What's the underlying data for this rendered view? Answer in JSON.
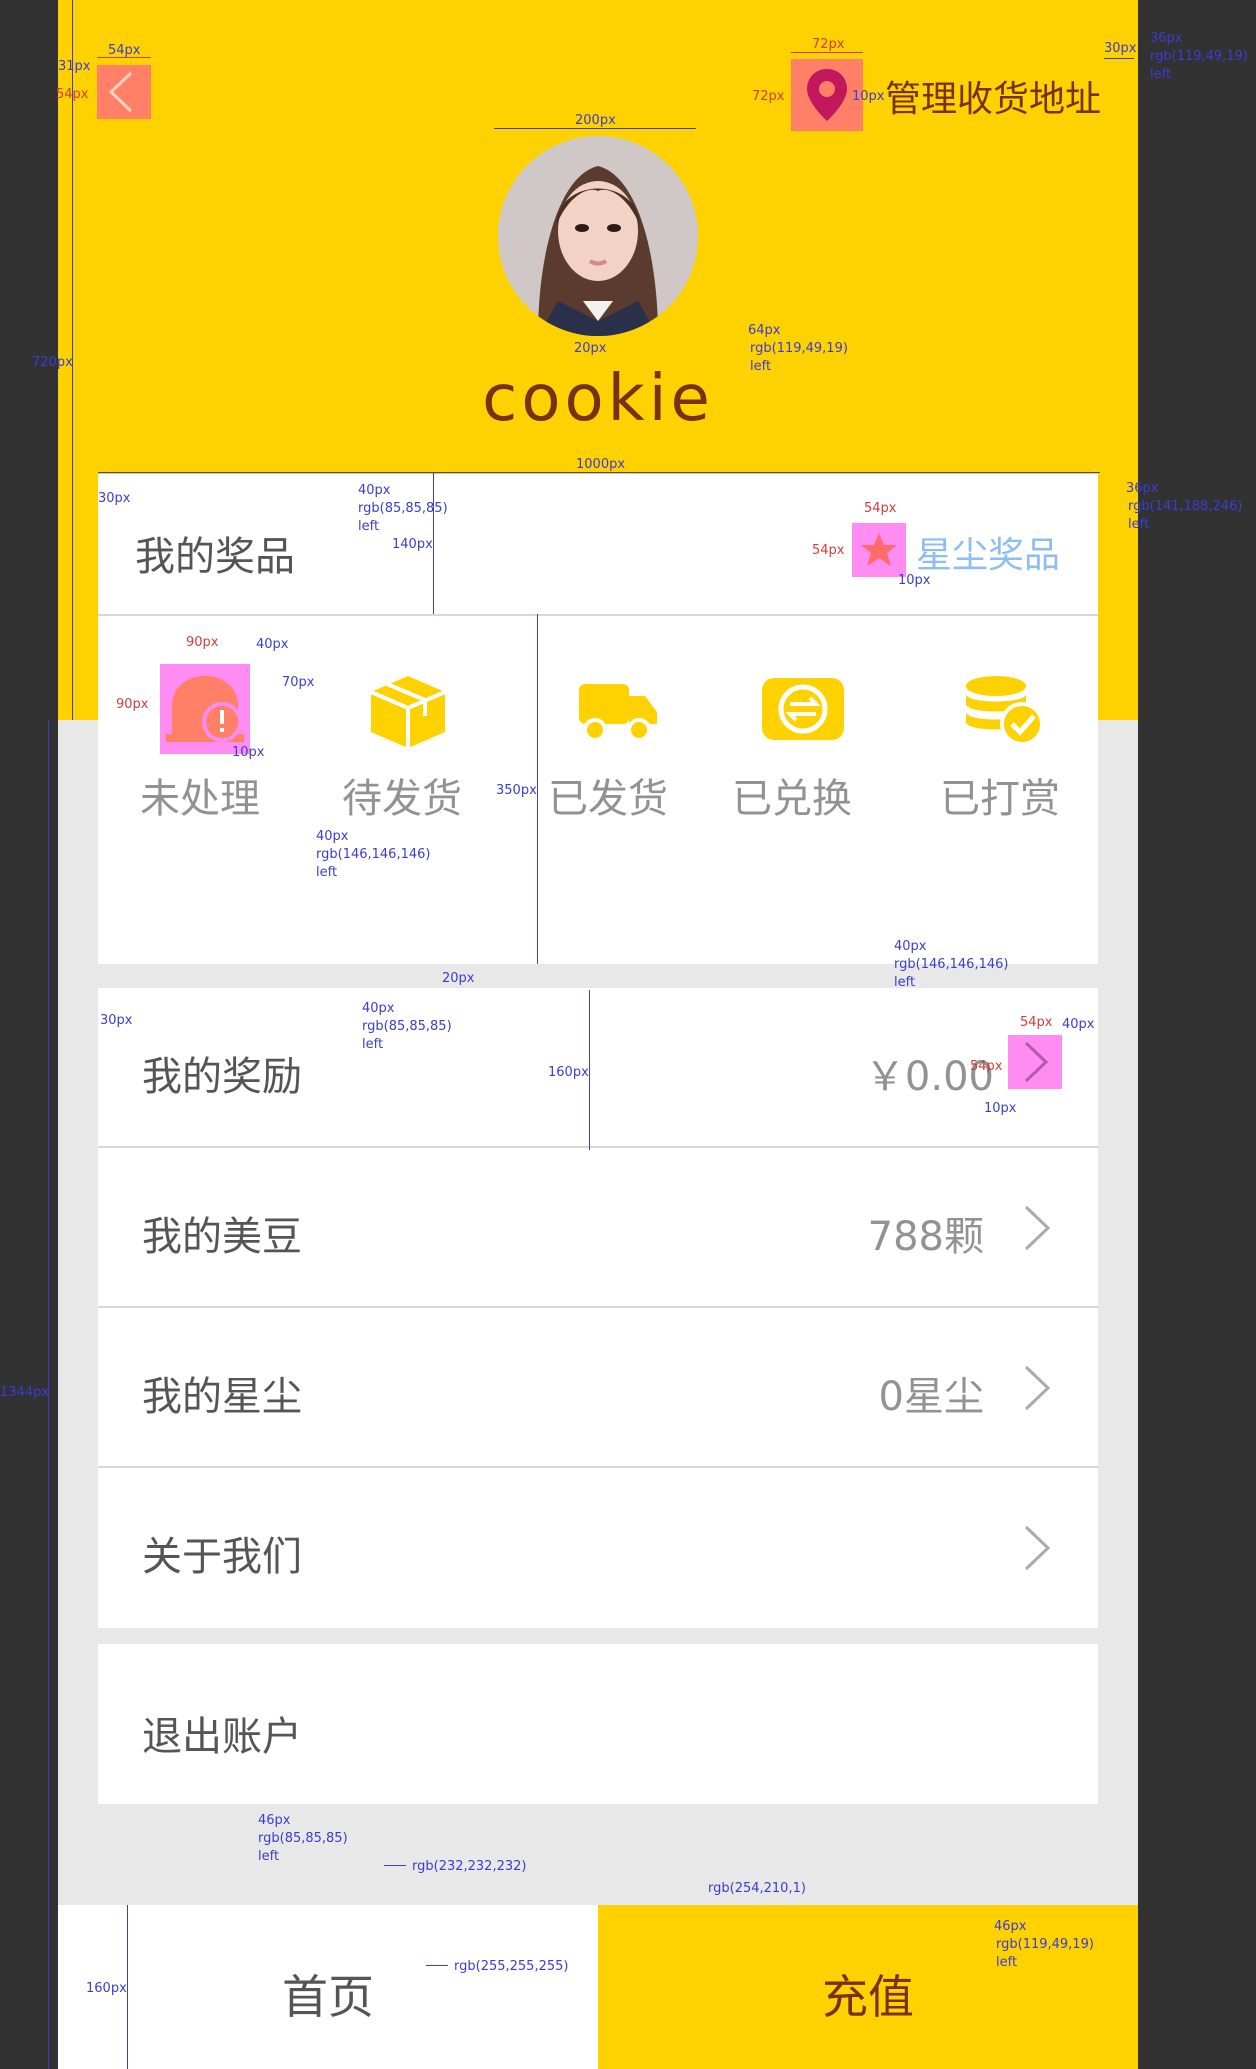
{
  "header": {
    "back_icon": "chevron-left-icon",
    "address_icon": "location-pin-icon",
    "address_label": "管理收货地址",
    "username": "cookie",
    "avatar": "user-avatar-photo"
  },
  "prizes": {
    "title": "我的奖品",
    "link_icon": "star-icon",
    "link_label": "星尘奖品",
    "tabs": [
      {
        "label": "未处理",
        "icon": "bell-alert-icon"
      },
      {
        "label": "待发货",
        "icon": "package-icon"
      },
      {
        "label": "已发货",
        "icon": "truck-icon"
      },
      {
        "label": "已兑换",
        "icon": "exchange-icon"
      },
      {
        "label": "已打赏",
        "icon": "coin-check-icon"
      }
    ]
  },
  "menu": {
    "rows": [
      {
        "label": "我的奖励",
        "value": "￥0.00"
      },
      {
        "label": "我的美豆",
        "value": "788颗"
      },
      {
        "label": "我的星尘",
        "value": "0星尘"
      },
      {
        "label": "关于我们",
        "value": ""
      }
    ],
    "logout": "退出账户"
  },
  "bottom_nav": {
    "home": "首页",
    "recharge": "充值"
  },
  "colors": {
    "accent": "#fed201",
    "dark_brown": "#773113",
    "text_dark": "#555555",
    "text_gray": "#929292",
    "link_blue": "#8dbcf6",
    "page_bg": "#e8e8e8",
    "highlight_pink": "#ff8cf0",
    "highlight_salmon": "#ff8066"
  },
  "annotations": {
    "a1": "31px",
    "a2": "54px",
    "a3": "54px",
    "a4": "72px",
    "a5": "72px",
    "a6": "10px",
    "a7": "36px",
    "a8": "rgb(119,49,19)",
    "a9": "left",
    "a10": "30px",
    "a11": "200px",
    "a12": "20px",
    "a13": "64px",
    "a14": "rgb(119,49,19)",
    "a15": "left",
    "a16": "720px",
    "a17": "1000px",
    "a18": "30px",
    "a19": "40px",
    "a20": "rgb(85,85,85)",
    "a21": "left",
    "a22": "140px",
    "a23": "54px",
    "a24": "54px",
    "a25": "36px",
    "a26": "rgb(141,188,246)",
    "a27": "left",
    "a28": "10px",
    "a29": "90px",
    "a30": "90px",
    "a31": "40px",
    "a32": "70px",
    "a33": "10px",
    "a34": "350px",
    "a35": "40px",
    "a36": "rgb(146,146,146)",
    "a37": "left",
    "a38": "1344px",
    "a39": "20px",
    "a40": "40px",
    "a41": "rgb(146,146,146)",
    "a42": "left",
    "a43": "30px",
    "a44": "40px",
    "a45": "rgb(85,85,85)",
    "a46": "left",
    "a47": "160px",
    "a48": "54px",
    "a49": "40px",
    "a50": "54px",
    "a51": "10px",
    "a52": "46px",
    "a53": "rgb(85,85,85)",
    "a54": "left",
    "a55": "rgb(232,232,232)",
    "a56": "rgb(254,210,1)",
    "a57": "160px",
    "a58": "rgb(255,255,255)",
    "a59": "46px",
    "a60": "rgb(119,49,19)",
    "a61": "left"
  }
}
